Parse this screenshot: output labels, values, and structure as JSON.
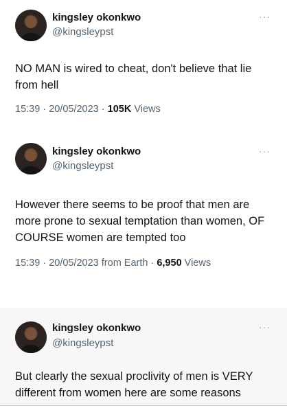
{
  "tweets": [
    {
      "name": "kingsley okonkwo",
      "handle": "@kingsleypst",
      "more": "···",
      "text": "NO MAN  is wired to cheat,  don't believe that lie from hell",
      "time": "15:39 · 20/05/2023 · ",
      "views_count": "105K",
      "views_label": " Views"
    },
    {
      "name": "kingsley okonkwo",
      "handle": "@kingsleypst",
      "more": "···",
      "text": "However there seems to be proof that men are more prone to sexual temptation than women, OF COURSE women are tempted too",
      "time": "15:39 · 20/05/2023 from Earth · ",
      "views_count": "6,950",
      "views_label": " Views"
    },
    {
      "name": "kingsley okonkwo",
      "handle": "@kingsleypst",
      "more": "···",
      "text": "But clearly the sexual proclivity of men is VERY different from women here are some reasons"
    }
  ]
}
